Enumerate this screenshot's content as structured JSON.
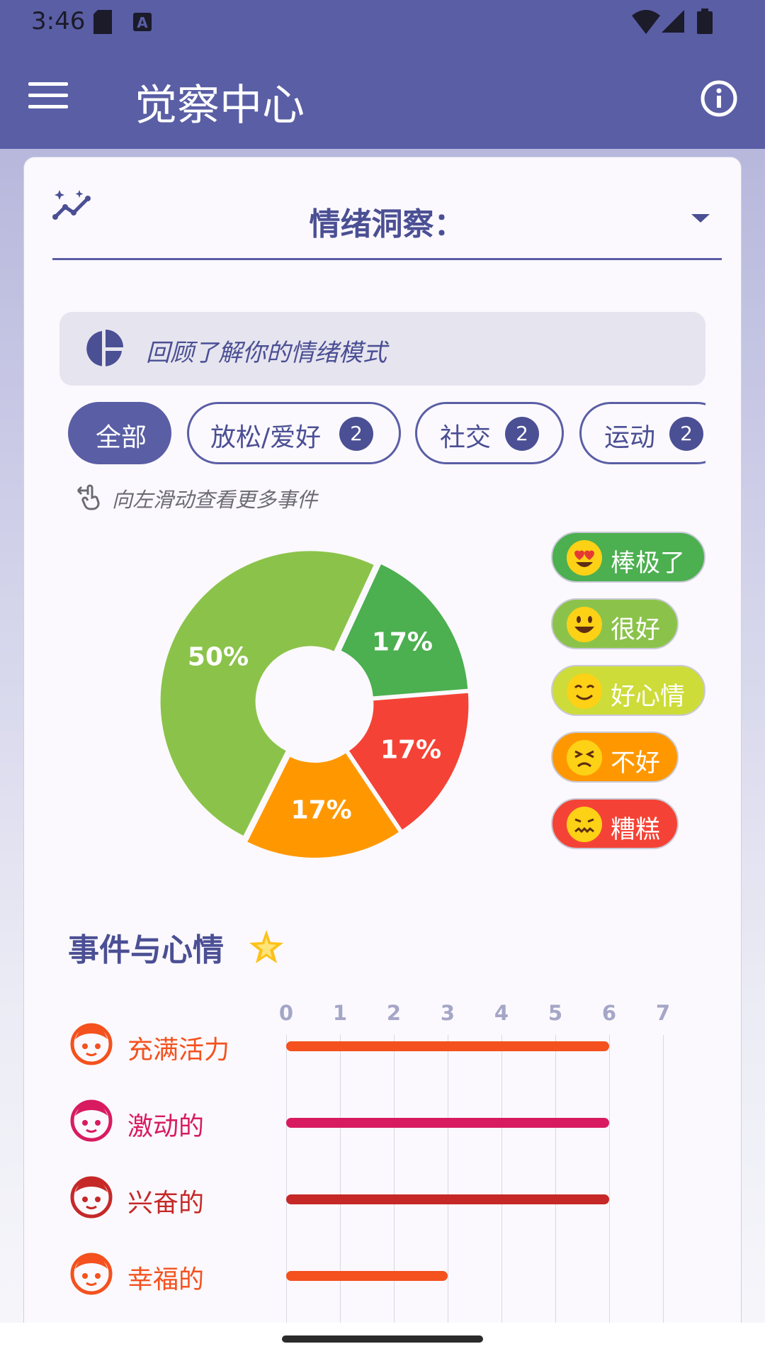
{
  "status_bar": {
    "time": "3:46"
  },
  "app_bar": {
    "title": "觉察中心",
    "menu_icon": "hamburger-menu-icon",
    "info_icon": "info-icon"
  },
  "dropdown": {
    "label": "情绪洞察："
  },
  "banner": {
    "text": "回顾了解你的情绪模式"
  },
  "chips": [
    {
      "label": "全部",
      "badge": null,
      "active": true
    },
    {
      "label": "放松/爱好",
      "badge": "2",
      "active": false
    },
    {
      "label": "社交",
      "badge": "2",
      "active": false
    },
    {
      "label": "运动",
      "badge": "2",
      "active": false
    }
  ],
  "hint": "向左滑动查看更多事件",
  "chart_data": [
    {
      "type": "pie",
      "slices": [
        {
          "label": "棒极了",
          "value": 17,
          "display": "17%",
          "color": "#4caf50"
        },
        {
          "label": "糟糕",
          "value": 17,
          "display": "17%",
          "color": "#f44336"
        },
        {
          "label": "不好",
          "value": 17,
          "display": "17%",
          "color": "#ff9800"
        },
        {
          "label": "很好",
          "value": 50,
          "display": "50%",
          "color": "#8bc34a"
        }
      ]
    },
    {
      "type": "bar",
      "orientation": "horizontal",
      "categories": [
        "充满活力",
        "激动的",
        "兴奋的",
        "幸福的"
      ],
      "values": [
        6,
        6,
        6,
        3
      ],
      "colors": [
        "#f4511e",
        "#d81b60",
        "#c62828",
        "#f4511e"
      ],
      "xlim": [
        0,
        7
      ],
      "xticks": [
        "0",
        "1",
        "2",
        "3",
        "4",
        "5",
        "6",
        "7"
      ]
    }
  ],
  "legend": [
    {
      "label": "棒极了",
      "color": "#4caf50",
      "emoji": "heart-eyes-face-icon"
    },
    {
      "label": "很好",
      "color": "#8bc34a",
      "emoji": "grinning-face-icon"
    },
    {
      "label": "好心情",
      "color": "#cddc39",
      "emoji": "smiling-face-icon"
    },
    {
      "label": "不好",
      "color": "#ff9800",
      "emoji": "sad-face-icon"
    },
    {
      "label": "糟糕",
      "color": "#f44336",
      "emoji": "nauseated-face-icon"
    }
  ],
  "events_section": {
    "title": "事件与心情",
    "star_icon": "glowing-star-icon"
  }
}
